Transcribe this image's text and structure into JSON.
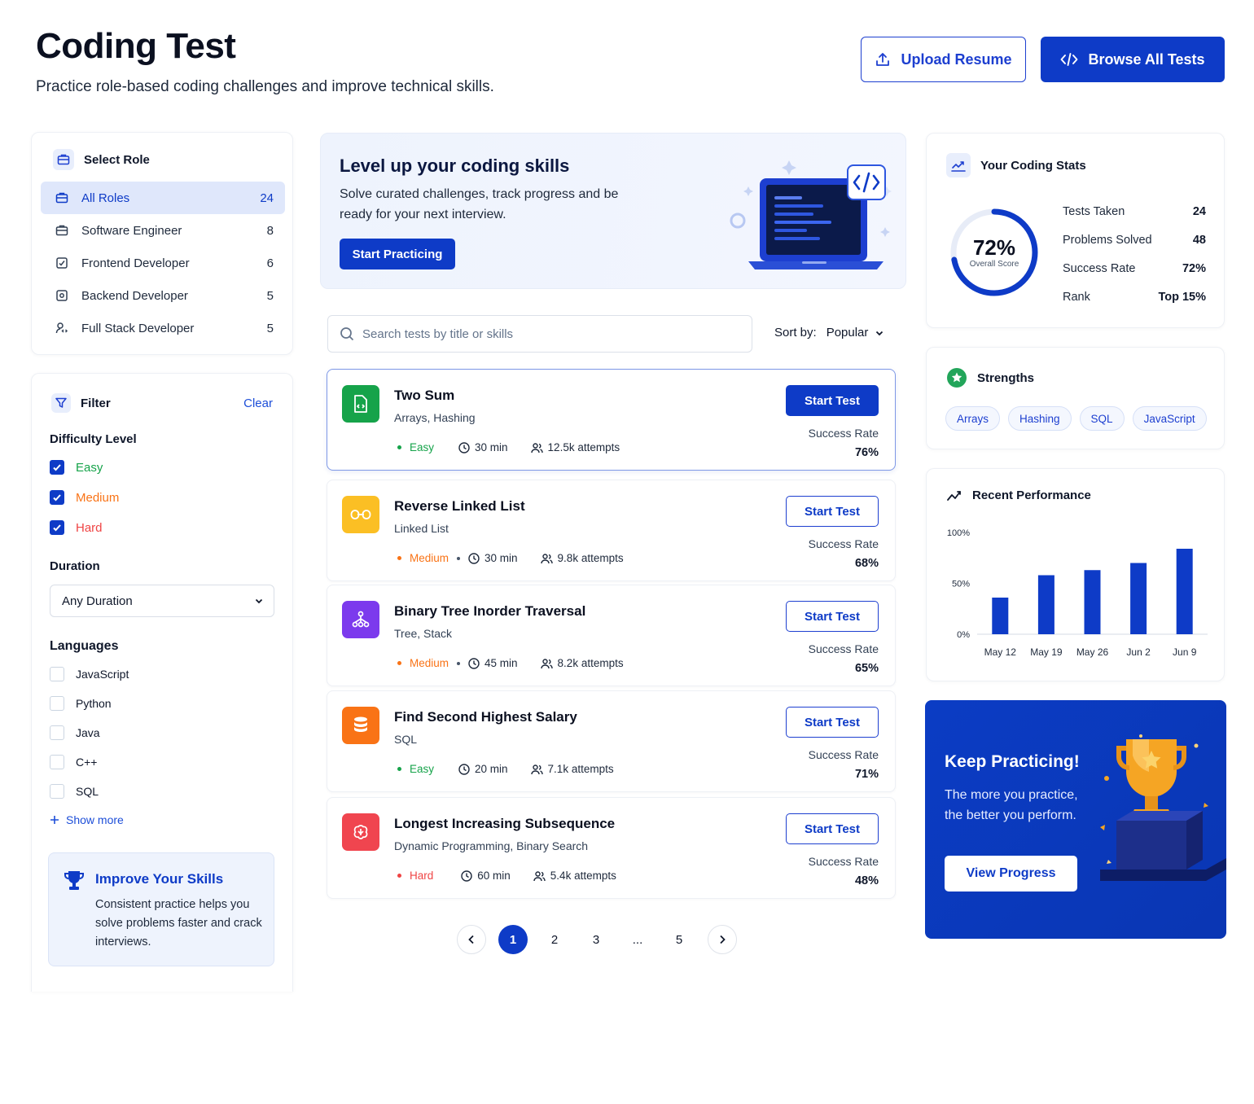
{
  "header": {
    "title": "Coding Test",
    "subtitle": "Practice role-based coding challenges and improve technical skills.",
    "upload_label": "Upload Resume",
    "browse_label": "Browse All Tests"
  },
  "roles": {
    "title": "Select Role",
    "items": [
      {
        "label": "All Roles",
        "count": "24",
        "active": true
      },
      {
        "label": "Software Engineer",
        "count": "8"
      },
      {
        "label": "Frontend Developer",
        "count": "6"
      },
      {
        "label": "Backend Developer",
        "count": "5"
      },
      {
        "label": "Full Stack Developer",
        "count": "5"
      }
    ]
  },
  "filter": {
    "title": "Filter",
    "clear_label": "Clear",
    "difficulty_label": "Difficulty Level",
    "difficulties": [
      {
        "label": "Easy",
        "checked": true,
        "color": "#16a34a"
      },
      {
        "label": "Medium",
        "checked": true,
        "color": "#f97316"
      },
      {
        "label": "Hard",
        "checked": true,
        "color": "#ef4444"
      }
    ],
    "duration_label": "Duration",
    "duration_value": "Any Duration",
    "languages_label": "Languages",
    "languages": [
      {
        "label": "JavaScript",
        "checked": false
      },
      {
        "label": "Python",
        "checked": false
      },
      {
        "label": "Java",
        "checked": false
      },
      {
        "label": "C++",
        "checked": false
      },
      {
        "label": "SQL",
        "checked": false
      }
    ],
    "show_more_label": "Show more",
    "improve": {
      "title": "Improve Your Skills",
      "text": "Consistent practice helps you solve problems faster and crack interviews."
    }
  },
  "hero": {
    "title": "Level up your coding skills",
    "text": "Solve curated challenges, track progress and be ready for your next interview.",
    "button_label": "Start Practicing"
  },
  "search": {
    "placeholder": "Search tests by title or skills",
    "sort_label": "Sort by:",
    "sort_value": "Popular"
  },
  "tests": [
    {
      "title": "Two Sum",
      "tags": "Arrays, Hashing",
      "difficulty": "Easy",
      "difficulty_color": "#16a34a",
      "duration": "30 min",
      "attempts": "12.5k attempts",
      "button": "Start Test",
      "success_label": "Success Rate",
      "success_rate": "76%",
      "icon": "code-file-icon",
      "icon_color": "#16a34a"
    },
    {
      "title": "Reverse Linked List",
      "tags": "Linked List",
      "difficulty": "Medium",
      "difficulty_color": "#f97316",
      "duration": "30 min",
      "attempts": "9.8k attempts",
      "button": "Start Test",
      "success_label": "Success Rate",
      "success_rate": "68%",
      "icon": "link-icon",
      "icon_color": "#fbbf24"
    },
    {
      "title": "Binary Tree Inorder Traversal",
      "tags": "Tree, Stack",
      "difficulty": "Medium",
      "difficulty_color": "#f97316",
      "duration": "45 min",
      "attempts": "8.2k attempts",
      "button": "Start Test",
      "success_label": "Success Rate",
      "success_rate": "65%",
      "icon": "tree-icon",
      "icon_color": "#7c3aed"
    },
    {
      "title": "Find Second Highest Salary",
      "tags": "SQL",
      "difficulty": "Easy",
      "difficulty_color": "#16a34a",
      "duration": "20 min",
      "attempts": "7.1k attempts",
      "button": "Start Test",
      "success_label": "Success Rate",
      "success_rate": "71%",
      "icon": "database-icon",
      "icon_color": "#f97316"
    },
    {
      "title": "Longest Increasing Subsequence",
      "tags": "Dynamic Programming, Binary Search",
      "difficulty": "Hard",
      "difficulty_color": "#ef4444",
      "duration": "60 min",
      "attempts": "5.4k attempts",
      "button": "Start Test",
      "success_label": "Success Rate",
      "success_rate": "48%",
      "icon": "brain-icon",
      "icon_color": "#f0454f"
    }
  ],
  "pagination": {
    "pages": [
      "1",
      "2",
      "3",
      "...",
      "5"
    ],
    "current": "1"
  },
  "stats": {
    "title": "Your Coding Stats",
    "overall_pct": "72%",
    "overall_value": 0.72,
    "overall_caption": "Overall Score",
    "rows": [
      {
        "label": "Tests Taken",
        "value": "24"
      },
      {
        "label": "Problems Solved",
        "value": "48"
      },
      {
        "label": "Success Rate",
        "value": "72%"
      },
      {
        "label": "Rank",
        "value": "Top 15%"
      }
    ]
  },
  "strengths": {
    "title": "Strengths",
    "items": [
      "Arrays",
      "Hashing",
      "SQL",
      "JavaScript"
    ]
  },
  "performance": {
    "title": "Recent Performance"
  },
  "chart_data": {
    "type": "bar",
    "categories": [
      "May 12",
      "May 19",
      "May 26",
      "Jun 2",
      "Jun 9"
    ],
    "values": [
      36,
      58,
      63,
      70,
      84
    ],
    "ylim": [
      0,
      100
    ],
    "yticks": [
      "0%",
      "50%",
      "100%"
    ],
    "ytick_values": [
      0,
      50,
      100
    ],
    "color": "#0e3bc7",
    "grid": false
  },
  "keep": {
    "title": "Keep Practicing!",
    "text": "The more you practice, the better you perform.",
    "button_label": "View Progress"
  },
  "colors": {
    "primary": "#0e3bc7",
    "accent_bg": "#eef3fd"
  }
}
